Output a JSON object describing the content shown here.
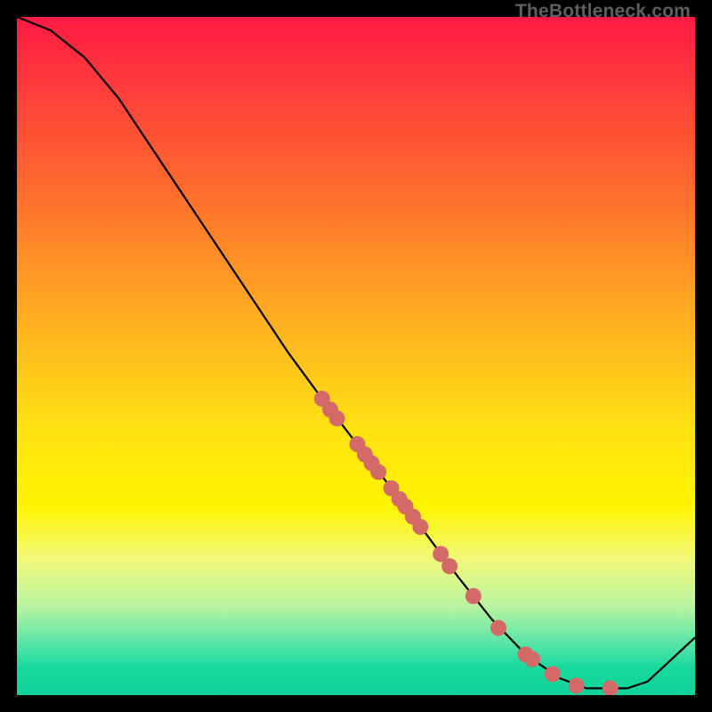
{
  "watermark": "TheBottleneck.com",
  "colors": {
    "frame": "#000000",
    "marker_fill": "#d46a67",
    "marker_stroke": "#b94f4c",
    "line": "#000000"
  },
  "chart_data": {
    "type": "line",
    "title": "",
    "xlabel": "",
    "ylabel": "",
    "xlim": [
      0,
      100
    ],
    "ylim": [
      0,
      100
    ],
    "grid": false,
    "legend": false,
    "curve": [
      {
        "x": 0,
        "y": 100
      },
      {
        "x": 5,
        "y": 98
      },
      {
        "x": 10,
        "y": 94
      },
      {
        "x": 15,
        "y": 88
      },
      {
        "x": 20,
        "y": 80.5
      },
      {
        "x": 25,
        "y": 73
      },
      {
        "x": 30,
        "y": 65.5
      },
      {
        "x": 35,
        "y": 58
      },
      {
        "x": 40,
        "y": 50.5
      },
      {
        "x": 45,
        "y": 43.7
      },
      {
        "x": 50,
        "y": 37.2
      },
      {
        "x": 55,
        "y": 30.8
      },
      {
        "x": 60,
        "y": 24.2
      },
      {
        "x": 65,
        "y": 17.5
      },
      {
        "x": 70,
        "y": 11.2
      },
      {
        "x": 75,
        "y": 6.0
      },
      {
        "x": 80,
        "y": 2.5
      },
      {
        "x": 84,
        "y": 1.0
      },
      {
        "x": 90,
        "y": 1.0
      },
      {
        "x": 93,
        "y": 2.0
      },
      {
        "x": 100,
        "y": 8.5
      }
    ],
    "markers": [
      {
        "x": 45.0,
        "y": 43.7
      },
      {
        "x": 46.2,
        "y": 42.1
      },
      {
        "x": 47.2,
        "y": 40.8
      },
      {
        "x": 50.2,
        "y": 37.0
      },
      {
        "x": 51.3,
        "y": 35.5
      },
      {
        "x": 52.3,
        "y": 34.2
      },
      {
        "x": 53.3,
        "y": 32.9
      },
      {
        "x": 55.2,
        "y": 30.5
      },
      {
        "x": 56.4,
        "y": 28.9
      },
      {
        "x": 57.3,
        "y": 27.8
      },
      {
        "x": 58.4,
        "y": 26.3
      },
      {
        "x": 59.5,
        "y": 24.8
      },
      {
        "x": 62.5,
        "y": 20.8
      },
      {
        "x": 63.8,
        "y": 19.0
      },
      {
        "x": 67.3,
        "y": 14.6
      },
      {
        "x": 71.0,
        "y": 9.9
      },
      {
        "x": 75.0,
        "y": 6.0
      },
      {
        "x": 76.0,
        "y": 5.3
      },
      {
        "x": 79.0,
        "y": 3.1
      },
      {
        "x": 82.5,
        "y": 1.4
      },
      {
        "x": 87.5,
        "y": 1.0
      }
    ],
    "marker_radius_px": 9
  }
}
